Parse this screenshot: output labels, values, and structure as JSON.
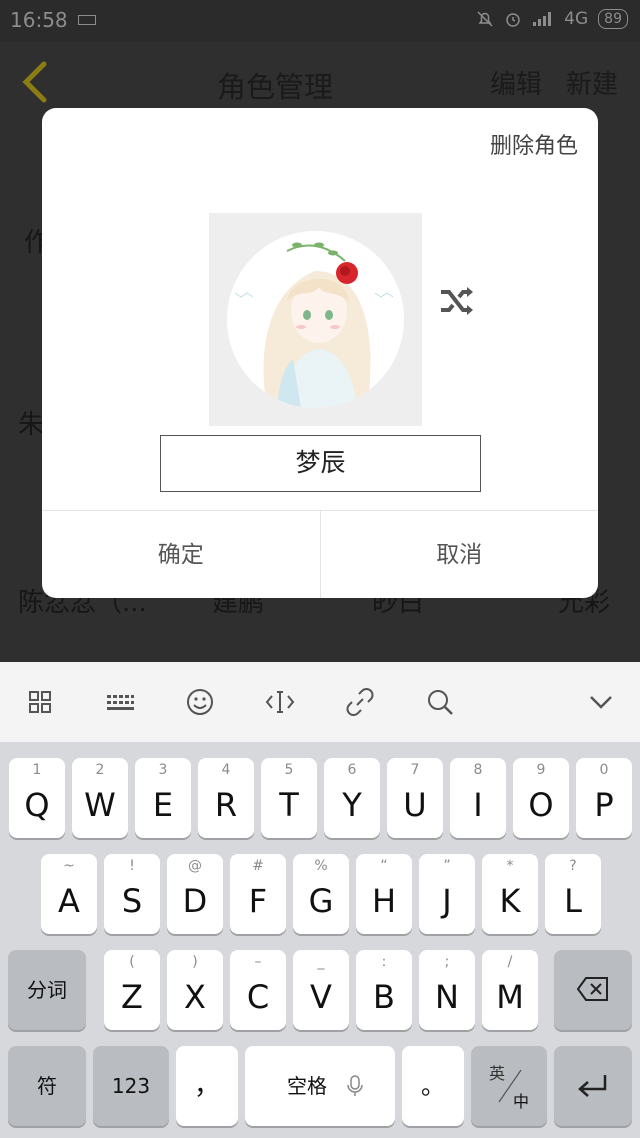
{
  "status_bar": {
    "time": "16:58",
    "network": "4G",
    "battery": "89"
  },
  "app": {
    "title": "角色管理",
    "edit_label": "编辑",
    "new_label": "新建",
    "partial_texts": [
      "作",
      "朱",
      "陈忿忿（...",
      "建鹏",
      "眇白",
      "允彩"
    ]
  },
  "dialog": {
    "delete_label": "删除角色",
    "name_value": "梦辰",
    "confirm_label": "确定",
    "cancel_label": "取消"
  },
  "keyboard": {
    "toolbar_icons": [
      "grid-icon",
      "keyboard-icon",
      "emoji-icon",
      "cursor-icon",
      "link-icon",
      "search-icon",
      "collapse-icon"
    ],
    "row1": [
      {
        "hint": "1",
        "key": "Q"
      },
      {
        "hint": "2",
        "key": "W"
      },
      {
        "hint": "3",
        "key": "E"
      },
      {
        "hint": "4",
        "key": "R"
      },
      {
        "hint": "5",
        "key": "T"
      },
      {
        "hint": "6",
        "key": "Y"
      },
      {
        "hint": "7",
        "key": "U"
      },
      {
        "hint": "8",
        "key": "I"
      },
      {
        "hint": "9",
        "key": "O"
      },
      {
        "hint": "0",
        "key": "P"
      }
    ],
    "row2": [
      {
        "hint": "~",
        "key": "A"
      },
      {
        "hint": "!",
        "key": "S"
      },
      {
        "hint": "@",
        "key": "D"
      },
      {
        "hint": "#",
        "key": "F"
      },
      {
        "hint": "%",
        "key": "G"
      },
      {
        "hint": "“",
        "key": "H"
      },
      {
        "hint": "”",
        "key": "J"
      },
      {
        "hint": "*",
        "key": "K"
      },
      {
        "hint": "?",
        "key": "L"
      }
    ],
    "row3": [
      {
        "hint": "(",
        "key": "Z"
      },
      {
        "hint": ")",
        "key": "X"
      },
      {
        "hint": "–",
        "key": "C"
      },
      {
        "hint": "_",
        "key": "V"
      },
      {
        "hint": ":",
        "key": "B"
      },
      {
        "hint": ";",
        "key": "N"
      },
      {
        "hint": "/",
        "key": "M"
      }
    ],
    "fenci_label": "分词",
    "symbols_label": "符",
    "numbers_label": "123",
    "comma_label": "，",
    "space_label": "空格",
    "period_label": "。",
    "lang_top": "英",
    "lang_bottom": "中"
  },
  "colors": {
    "overlay_bg": "#2f2f2f",
    "dialog_bg": "#ffffff",
    "back_arrow": "#9a8a1a",
    "keyboard_bg": "#d7d8db"
  }
}
